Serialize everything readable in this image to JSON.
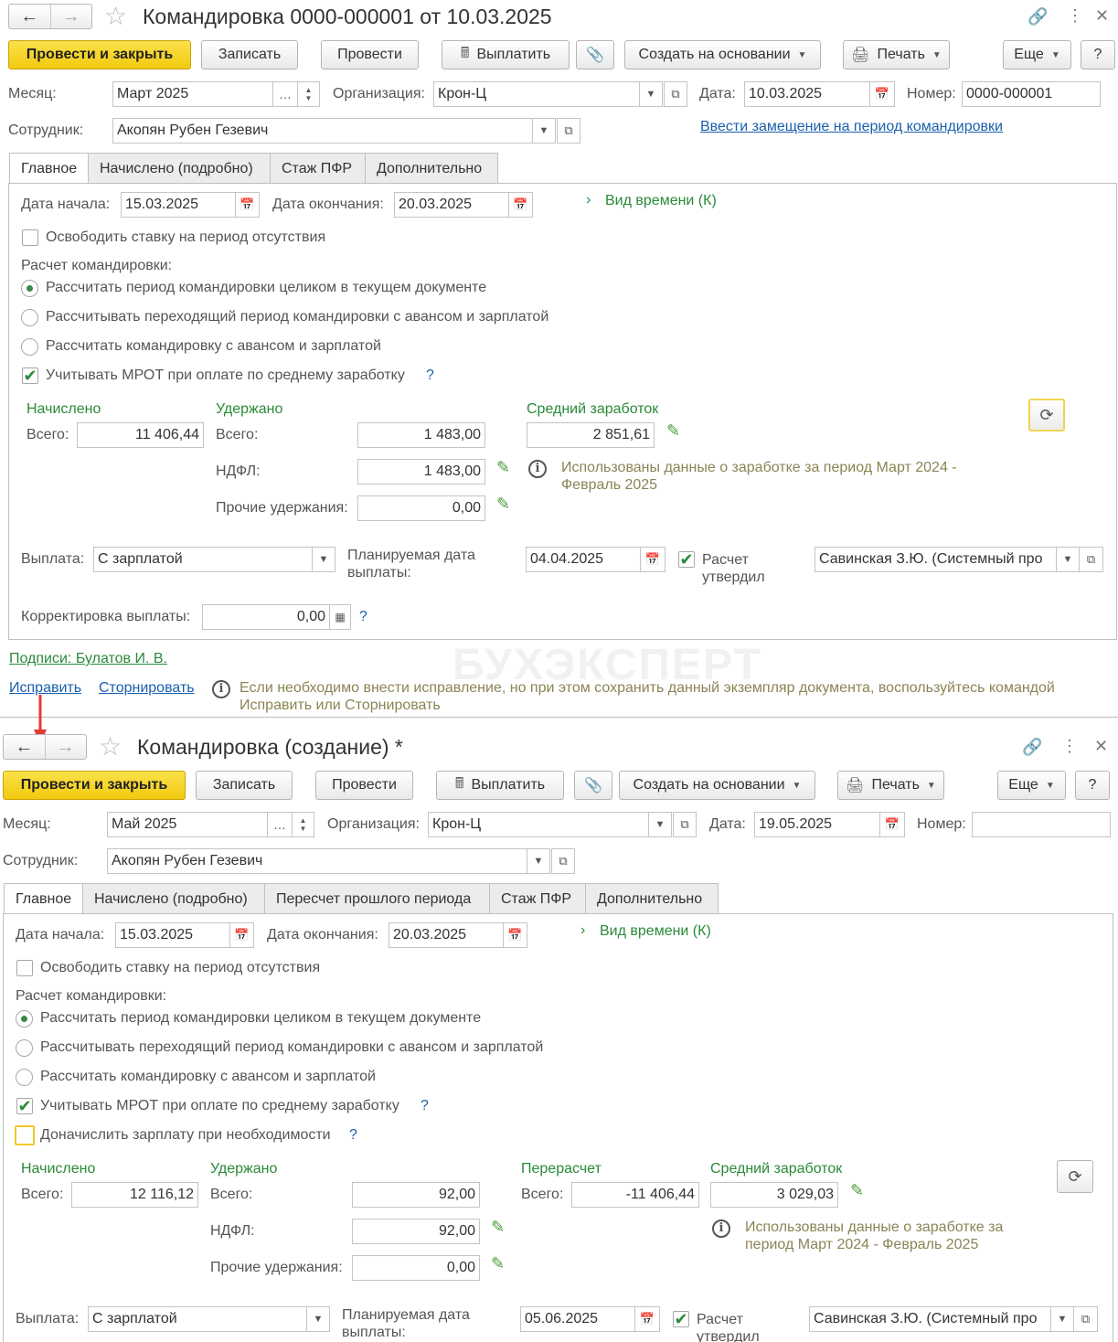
{
  "doc1": {
    "title": "Командировка 0000-000001 от 10.03.2025",
    "toolbar": {
      "post_close": "Провести и закрыть",
      "save": "Записать",
      "post": "Провести",
      "pay": "Выплатить",
      "create_based": "Создать на основании",
      "print": "Печать",
      "more": "Еще",
      "help": "?"
    },
    "month_label": "Месяц:",
    "month_value": "Март 2025",
    "org_label": "Организация:",
    "org_value": "Крон-Ц",
    "date_label": "Дата:",
    "date_value": "10.03.2025",
    "number_label": "Номер:",
    "number_value": "0000-000001",
    "employee_label": "Сотрудник:",
    "employee_value": "Акопян Рубен Гезевич",
    "replacement_link": "Ввести замещение на период командировки",
    "tabs": [
      "Главное",
      "Начислено (подробно)",
      "Стаж ПФР",
      "Дополнительно"
    ],
    "start_label": "Дата начала:",
    "start_value": "15.03.2025",
    "end_label": "Дата окончания:",
    "end_value": "20.03.2025",
    "time_kind": "Вид времени (К)",
    "free_rate": "Освободить ставку на период отсутствия",
    "calc_label": "Расчет командировки:",
    "radio1": "Рассчитать период командировки целиком в текущем документе",
    "radio2": "Рассчитывать переходящий период командировки с авансом и зарплатой",
    "radio3": "Рассчитать командировку с авансом и зарплатой",
    "mrot": "Учитывать МРОТ при оплате по среднему заработку",
    "accrued_head": "Начислено",
    "total_label": "Всего:",
    "accrued_total": "11 406,44",
    "withheld_head": "Удержано",
    "withheld_total": "1 483,00",
    "ndfl_label": "НДФЛ:",
    "ndfl_value": "1 483,00",
    "other_label": "Прочие удержания:",
    "other_value": "0,00",
    "avg_head": "Средний заработок",
    "avg_value": "2 851,61",
    "avg_info": "Использованы данные о заработке за период Март 2024 - Февраль 2025",
    "payout_label": "Выплата:",
    "payout_value": "С зарплатой",
    "planned_label": "Планируемая дата выплаты:",
    "planned_value": "04.04.2025",
    "approved_label": "Расчет утвердил",
    "approver_value": "Савинская З.Ю. (Системный про",
    "correction_label": "Корректировка выплаты:",
    "correction_value": "0,00",
    "signatures": "Подписи: Булатов И. В.",
    "fix_link": "Исправить",
    "storno_link": "Сторнировать",
    "fix_info": "Если необходимо внести исправление, но при этом сохранить данный экземпляр документа, воспользуйтесь командой Исправить или Сторнировать"
  },
  "doc2": {
    "title": "Командировка (создание) *",
    "toolbar": {
      "post_close": "Провести и закрыть",
      "save": "Записать",
      "post": "Провести",
      "pay": "Выплатить",
      "create_based": "Создать на основании",
      "print": "Печать",
      "more": "Еще",
      "help": "?"
    },
    "month_label": "Месяц:",
    "month_value": "Май 2025",
    "org_label": "Организация:",
    "org_value": "Крон-Ц",
    "date_label": "Дата:",
    "date_value": "19.05.2025",
    "number_label": "Номер:",
    "number_value": "",
    "employee_label": "Сотрудник:",
    "employee_value": "Акопян Рубен Гезевич",
    "tabs": [
      "Главное",
      "Начислено (подробно)",
      "Пересчет прошлого периода",
      "Стаж ПФР",
      "Дополнительно"
    ],
    "start_label": "Дата начала:",
    "start_value": "15.03.2025",
    "end_label": "Дата окончания:",
    "end_value": "20.03.2025",
    "time_kind": "Вид времени (К)",
    "free_rate": "Освободить ставку на период отсутствия",
    "calc_label": "Расчет командировки:",
    "radio1": "Рассчитать период командировки целиком в текущем документе",
    "radio2": "Рассчитывать переходящий период командировки с авансом и зарплатой",
    "radio3": "Рассчитать командировку с авансом и зарплатой",
    "mrot": "Учитывать МРОТ при оплате по среднему заработку",
    "extra_pay": "Доначислить зарплату при необходимости",
    "accrued_head": "Начислено",
    "total_label": "Всего:",
    "accrued_total": "12 116,12",
    "withheld_head": "Удержано",
    "withheld_total": "92,00",
    "ndfl_label": "НДФЛ:",
    "ndfl_value": "92,00",
    "other_label": "Прочие удержания:",
    "other_value": "0,00",
    "recalc_head": "Перерасчет",
    "recalc_total": "-11 406,44",
    "avg_head": "Средний заработок",
    "avg_value": "3 029,03",
    "avg_info": "Использованы данные о заработке за период Март 2024 - Февраль 2025",
    "payout_label": "Выплата:",
    "payout_value": "С зарплатой",
    "planned_label": "Планируемая дата выплаты:",
    "planned_value": "05.06.2025",
    "approved_label": "Расчет утвердил",
    "approver_value": "Савинская З.Ю. (Системный про"
  },
  "watermark": "БУХЭКСПЕРТ",
  "icons": {
    "back": "arrow-left-icon",
    "forward": "arrow-right-icon",
    "favorite": "star-icon",
    "link": "link-icon",
    "menu": "more-vertical-icon",
    "close": "close-icon",
    "calendar": "calendar-icon",
    "dropdown": "chevron-down-icon",
    "open": "open-form-icon",
    "pencil": "pencil-icon",
    "info": "info-icon",
    "refresh": "refresh-icon",
    "clip": "paperclip-icon",
    "printer": "printer-icon",
    "calculator": "calculator-icon"
  },
  "colors": {
    "primary_button": "#f5d21f",
    "link": "#1a5fad",
    "green": "#2a8a38",
    "info_text": "#8b8455",
    "arrow": "#e53935"
  }
}
